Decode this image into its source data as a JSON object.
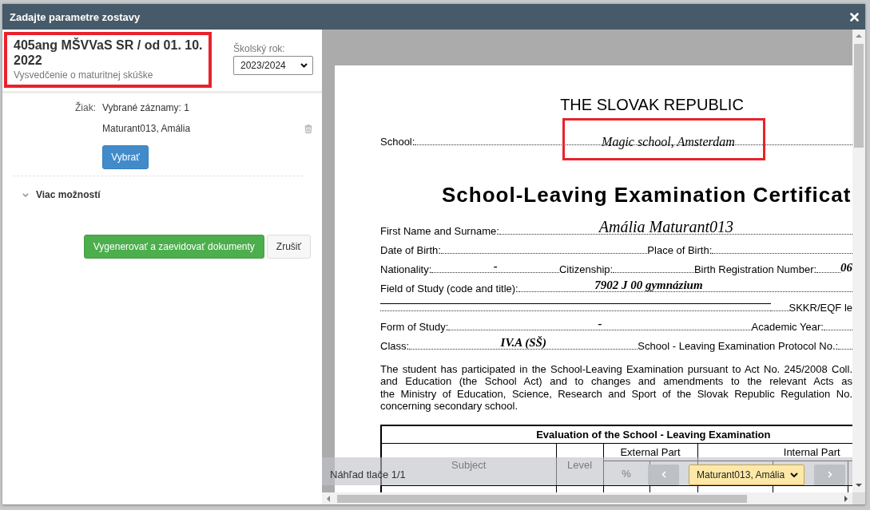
{
  "window": {
    "title": "Zadajte parametre zostavy"
  },
  "report": {
    "title": "405ang MŠVVaS SR / od 01. 10. 2022",
    "subtitle": "Vysvedčenie o maturitnej skúške",
    "highlighted": true
  },
  "school_year": {
    "label": "Školský rok:",
    "value": "2023/2024"
  },
  "student": {
    "label": "Žiak:",
    "summary": "Vybrané záznamy: 1",
    "records": [
      {
        "name": "Maturant013, Amália"
      }
    ],
    "select_button": "Vybrať"
  },
  "more_options": {
    "label": "Viac možností",
    "expanded": false
  },
  "actions": [
    {
      "label": "Vygenerovať a zaevidovať dokumenty",
      "kind": "primary"
    },
    {
      "label": "Zrušiť",
      "kind": "default"
    }
  ],
  "document": {
    "heading": "THE SLOVAK REPUBLIC",
    "school": {
      "label": "School:",
      "value": "Magic school, Amsterdam",
      "highlighted": true
    },
    "title": "School-Leaving Examination Certificat",
    "fields": [
      [
        {
          "kind": "label",
          "text": "First Name and Surname:"
        },
        {
          "kind": "leader",
          "value": "Amália Maturant013"
        }
      ],
      [
        {
          "kind": "label",
          "text": "Date of Birth:"
        },
        {
          "kind": "leader"
        },
        {
          "kind": "label",
          "text": "Place of Birth:"
        },
        {
          "kind": "leader"
        }
      ],
      [
        {
          "kind": "label",
          "text": "Nationality:"
        },
        {
          "kind": "leader",
          "value": "-"
        },
        {
          "kind": "label",
          "text": "Citizenship:"
        },
        {
          "kind": "leader"
        },
        {
          "kind": "label",
          "text": "Birth Registration Number:"
        },
        {
          "kind": "leader"
        },
        {
          "kind": "value",
          "text": "06"
        }
      ],
      [
        {
          "kind": "label",
          "text": "Field of Study (code and title):"
        },
        {
          "kind": "leader",
          "value": "7902 J 00 gymnázium"
        }
      ],
      [
        {
          "kind": "rule"
        },
        {
          "kind": "leader"
        },
        {
          "kind": "label",
          "text": "SKKR/EQF le"
        }
      ],
      [
        {
          "kind": "label",
          "text": "Form of Study:"
        },
        {
          "kind": "leader",
          "value": "-"
        },
        {
          "kind": "label",
          "text": "Academic Year:"
        },
        {
          "kind": "leader"
        }
      ],
      [
        {
          "kind": "label",
          "text": "Class:"
        },
        {
          "kind": "leader",
          "value": "IV.A (SŠ)"
        },
        {
          "kind": "label",
          "text": "School - Leaving Examination Protocol No.:"
        },
        {
          "kind": "leader"
        }
      ]
    ],
    "paragraph": [
      "The student has participated in the School-Leaving Examination pursuant to Act No. 245/2008 Coll.",
      "and Education (the School Act) and to changes and amendments to the relevant Acts as",
      "the Ministry of Education, Science, Research and Sport of the Slovak Republic Regulation No.",
      "concerning secondary school."
    ],
    "table": {
      "title": "Evaluation of the School - Leaving Examination",
      "headers": [
        {
          "label": "Subject"
        },
        {
          "label": "Level"
        }
      ],
      "external_part": {
        "label": "External Part",
        "columns": [
          "%"
        ]
      },
      "internal_part": {
        "label": "Internal Part"
      }
    }
  },
  "preview_toolbar": {
    "page_label": "Náhľad tlače 1/1",
    "student": "Maturant013, Amália"
  }
}
